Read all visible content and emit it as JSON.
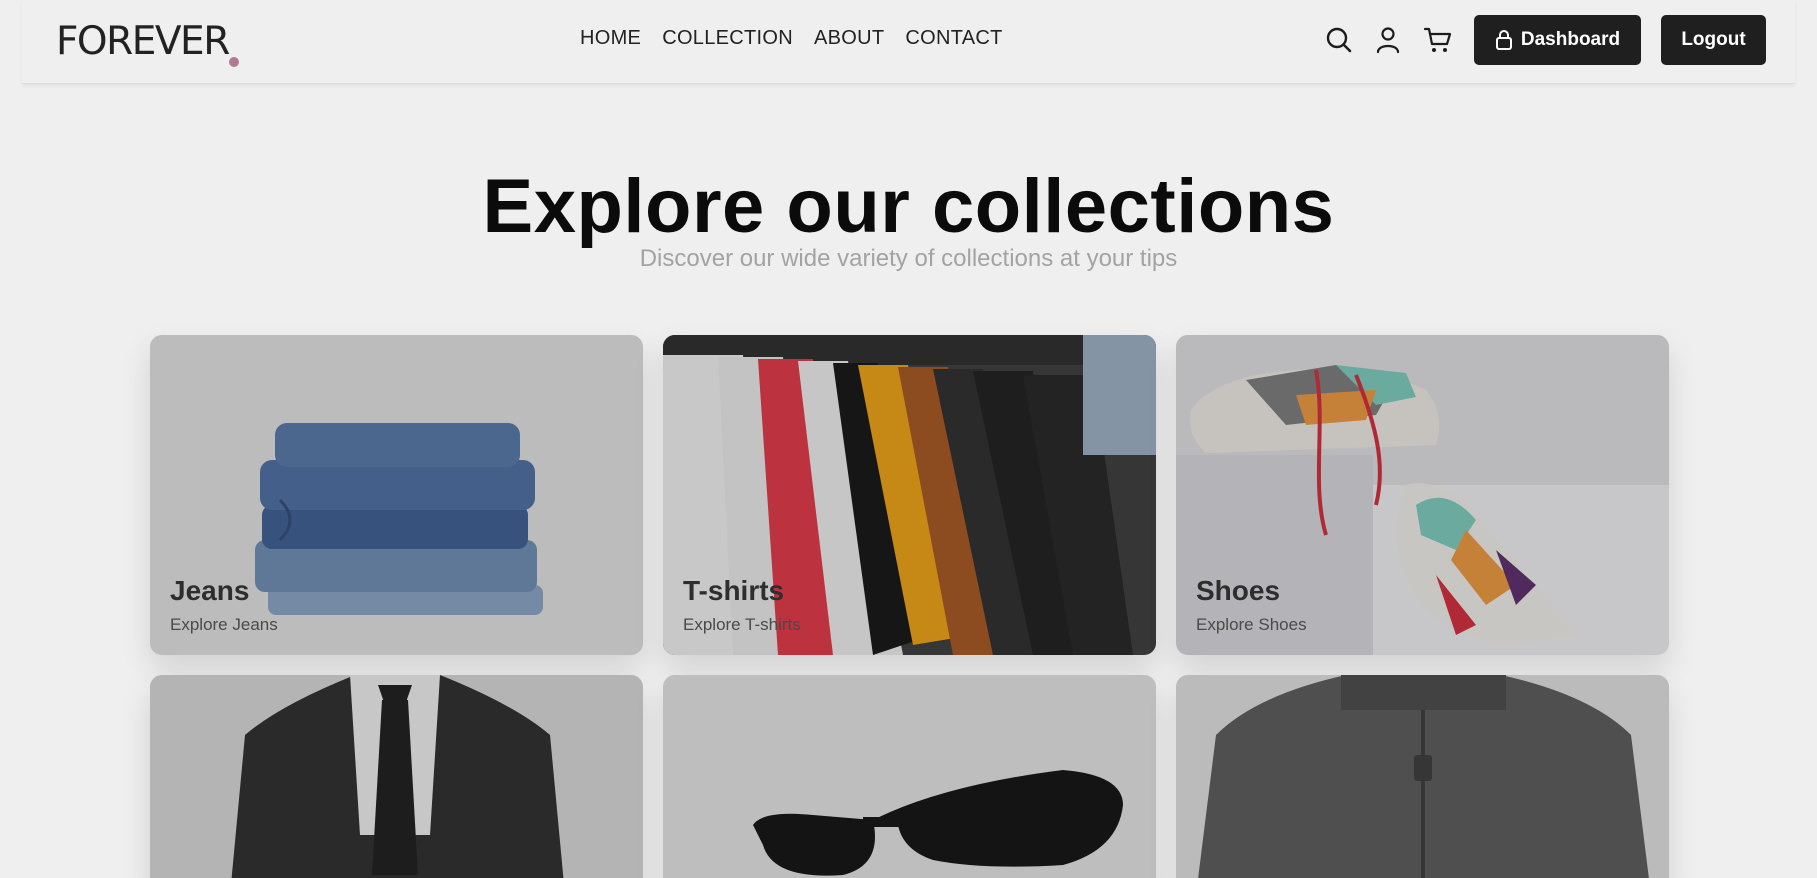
{
  "header": {
    "logo": "FOREVER",
    "nav": [
      "HOME",
      "COLLECTION",
      "ABOUT",
      "CONTACT"
    ],
    "icons": [
      "search-icon",
      "user-icon",
      "cart-icon",
      "lock-icon"
    ],
    "dashboard_label": "Dashboard",
    "logout_label": "Logout"
  },
  "hero": {
    "title": "Explore our collections",
    "subtitle": "Discover our wide variety of collections at your tips"
  },
  "collections": [
    {
      "title": "Jeans",
      "subtitle": "Explore Jeans"
    },
    {
      "title": "T-shirts",
      "subtitle": "Explore T-shirts"
    },
    {
      "title": "Shoes",
      "subtitle": "Explore Shoes"
    },
    {
      "title": "",
      "subtitle": ""
    },
    {
      "title": "",
      "subtitle": ""
    },
    {
      "title": "",
      "subtitle": ""
    }
  ],
  "colors": {
    "page_bg": "#efefef",
    "button_bg": "#1f1f1f",
    "logo_dot": "#b07a93",
    "subtitle": "#a3a3a3"
  }
}
